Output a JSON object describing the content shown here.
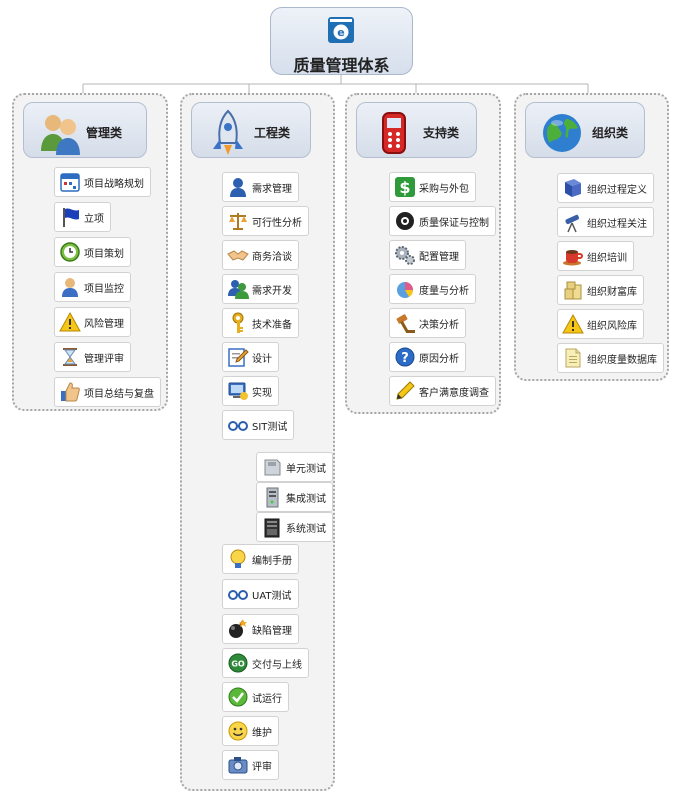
{
  "root": {
    "title": "质量管理体系",
    "icon": "logo-e-icon"
  },
  "categories": [
    {
      "title": "管理类",
      "icon": "people-icon",
      "items": [
        {
          "label": "项目战略规划",
          "icon": "calendar-icon"
        },
        {
          "label": "立项",
          "icon": "flag-icon"
        },
        {
          "label": "项目策划",
          "icon": "clock-icon"
        },
        {
          "label": "项目监控",
          "icon": "person-icon"
        },
        {
          "label": "风险管理",
          "icon": "warning-icon"
        },
        {
          "label": "管理评审",
          "icon": "hourglass-icon"
        },
        {
          "label": "项目总结与复盘",
          "icon": "thumbs-up-icon"
        }
      ]
    },
    {
      "title": "工程类",
      "icon": "rocket-icon",
      "items": [
        {
          "label": "需求管理",
          "icon": "person-icon"
        },
        {
          "label": "可行性分析",
          "icon": "scale-icon"
        },
        {
          "label": "商务洽谈",
          "icon": "handshake-icon"
        },
        {
          "label": "需求开发",
          "icon": "people-icon"
        },
        {
          "label": "技术准备",
          "icon": "key-icon"
        },
        {
          "label": "设计",
          "icon": "edit-icon"
        },
        {
          "label": "实现",
          "icon": "computer-icon"
        },
        {
          "label": "SIT测试",
          "icon": "glasses-icon",
          "children": [
            {
              "label": "单元测试",
              "icon": "disk-icon"
            },
            {
              "label": "集成测试",
              "icon": "server-icon"
            },
            {
              "label": "系统测试",
              "icon": "tower-icon"
            }
          ]
        },
        {
          "label": "编制手册",
          "icon": "bulb-icon"
        },
        {
          "label": "UAT测试",
          "icon": "glasses-icon"
        },
        {
          "label": "缺陷管理",
          "icon": "bomb-icon"
        },
        {
          "label": "交付与上线",
          "icon": "go-icon"
        },
        {
          "label": "试运行",
          "icon": "check-icon"
        },
        {
          "label": "维护",
          "icon": "smiley-icon"
        },
        {
          "label": "评审",
          "icon": "camera-icon"
        }
      ]
    },
    {
      "title": "支持类",
      "icon": "phone-icon",
      "items": [
        {
          "label": "采购与外包",
          "icon": "dollar-icon"
        },
        {
          "label": "质量保证与控制",
          "icon": "eye-icon"
        },
        {
          "label": "配置管理",
          "icon": "gears-icon"
        },
        {
          "label": "度量与分析",
          "icon": "pie-chart-icon"
        },
        {
          "label": "决策分析",
          "icon": "gavel-icon"
        },
        {
          "label": "原因分析",
          "icon": "question-icon"
        },
        {
          "label": "客户满意度调查",
          "icon": "pencil-icon"
        }
      ]
    },
    {
      "title": "组织类",
      "icon": "globe-icon",
      "items": [
        {
          "label": "组织过程定义",
          "icon": "book-icon"
        },
        {
          "label": "组织过程关注",
          "icon": "telescope-icon"
        },
        {
          "label": "组织培训",
          "icon": "coffee-icon"
        },
        {
          "label": "组织财富库",
          "icon": "coins-icon"
        },
        {
          "label": "组织风险库",
          "icon": "warning-icon"
        },
        {
          "label": "组织度量数据库",
          "icon": "document-icon"
        }
      ]
    }
  ],
  "colors": {
    "line": "#b5b5b5",
    "group_border": "#a6a6a6",
    "node_border": "#d2d2d2",
    "category_bg": "#dde4ef"
  }
}
